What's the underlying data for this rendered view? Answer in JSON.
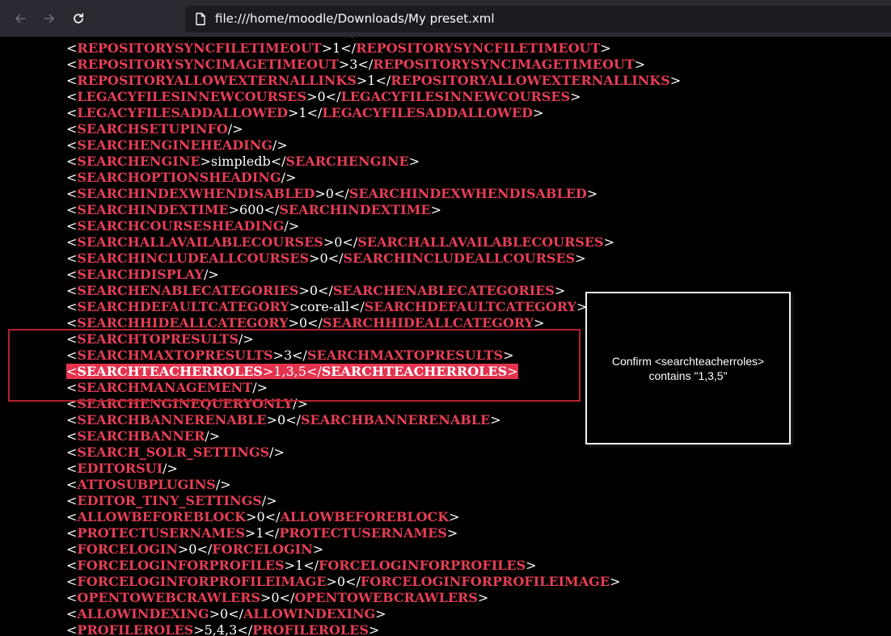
{
  "browser": {
    "url": "file:///home/moodle/Downloads/My preset.xml",
    "icons": {
      "back": "arrow-left-icon",
      "forward": "arrow-right-icon",
      "reload": "reload-icon",
      "page": "page-icon"
    }
  },
  "xml_lines": [
    {
      "tag": "REPOSITORYSYNCFILETIMEOUT",
      "value": "1"
    },
    {
      "tag": "REPOSITORYSYNCFILETIMEOUT",
      "value": "1"
    },
    {
      "tag": "REPOSITORYSYNCIMAGETIMEOUT",
      "value": "3"
    },
    {
      "tag": "REPOSITORYALLOWEXTERNALLINKS",
      "value": "1"
    },
    {
      "tag": "LEGACYFILESINNEWCOURSES",
      "value": "0"
    },
    {
      "tag": "LEGACYFILESADDALLOWED",
      "value": "1"
    },
    {
      "tag": "SEARCHSETUPINFO",
      "empty": true
    },
    {
      "tag": "SEARCHENGINEHEADING",
      "empty": true
    },
    {
      "tag": "SEARCHENGINE",
      "value": "simpledb"
    },
    {
      "tag": "SEARCHOPTIONSHEADING",
      "empty": true
    },
    {
      "tag": "SEARCHINDEXWHENDISABLED",
      "value": "0"
    },
    {
      "tag": "SEARCHINDEXTIME",
      "value": "600"
    },
    {
      "tag": "SEARCHCOURSESHEADING",
      "empty": true
    },
    {
      "tag": "SEARCHALLAVAILABLECOURSES",
      "value": "0"
    },
    {
      "tag": "SEARCHINCLUDEALLCOURSES",
      "value": "0"
    },
    {
      "tag": "SEARCHDISPLAY",
      "empty": true
    },
    {
      "tag": "SEARCHENABLECATEGORIES",
      "value": "0"
    },
    {
      "tag": "SEARCHDEFAULTCATEGORY",
      "value": "core-all"
    },
    {
      "tag": "SEARCHHIDEALLCATEGORY",
      "value": "0"
    },
    {
      "tag": "SEARCHTOPRESULTS",
      "empty": true
    },
    {
      "tag": "SEARCHMAXTOPRESULTS",
      "value": "3"
    },
    {
      "tag": "SEARCHTEACHERROLES",
      "value": "1,3,5",
      "highlighted": true
    },
    {
      "tag": "SEARCHMANAGEMENT",
      "empty": true
    },
    {
      "tag": "SEARCHENGINEQUERYONLY",
      "empty": true
    },
    {
      "tag": "SEARCHBANNERENABLE",
      "value": "0"
    },
    {
      "tag": "SEARCHBANNER",
      "empty": true
    },
    {
      "tag": "SEARCH_SOLR_SETTINGS",
      "empty": true
    },
    {
      "tag": "EDITORSUI",
      "empty": true
    },
    {
      "tag": "ATTOSUBPLUGINS",
      "empty": true
    },
    {
      "tag": "EDITOR_TINY_SETTINGS",
      "empty": true
    },
    {
      "tag": "ALLOWBEFOREBLOCK",
      "value": "0"
    },
    {
      "tag": "PROTECTUSERNAMES",
      "value": "1"
    },
    {
      "tag": "FORCELOGIN",
      "value": "0"
    },
    {
      "tag": "FORCELOGINFORPROFILES",
      "value": "1"
    },
    {
      "tag": "FORCELOGINFORPROFILEIMAGE",
      "value": "0"
    },
    {
      "tag": "OPENTOWEBCRAWLERS",
      "value": "0"
    },
    {
      "tag": "ALLOWINDEXING",
      "value": "0"
    },
    {
      "tag": "PROFILEROLES",
      "value": "5,4,3"
    }
  ],
  "annotation": {
    "tooltip_line1": "Confirm <searchteacherroles>",
    "tooltip_line2": "contains \"1,3,5\""
  },
  "colors": {
    "tag": "#e63e54",
    "highlight": "#e4334f",
    "box_border": "#b3222f",
    "background": "#000000",
    "text": "#ffffff"
  }
}
